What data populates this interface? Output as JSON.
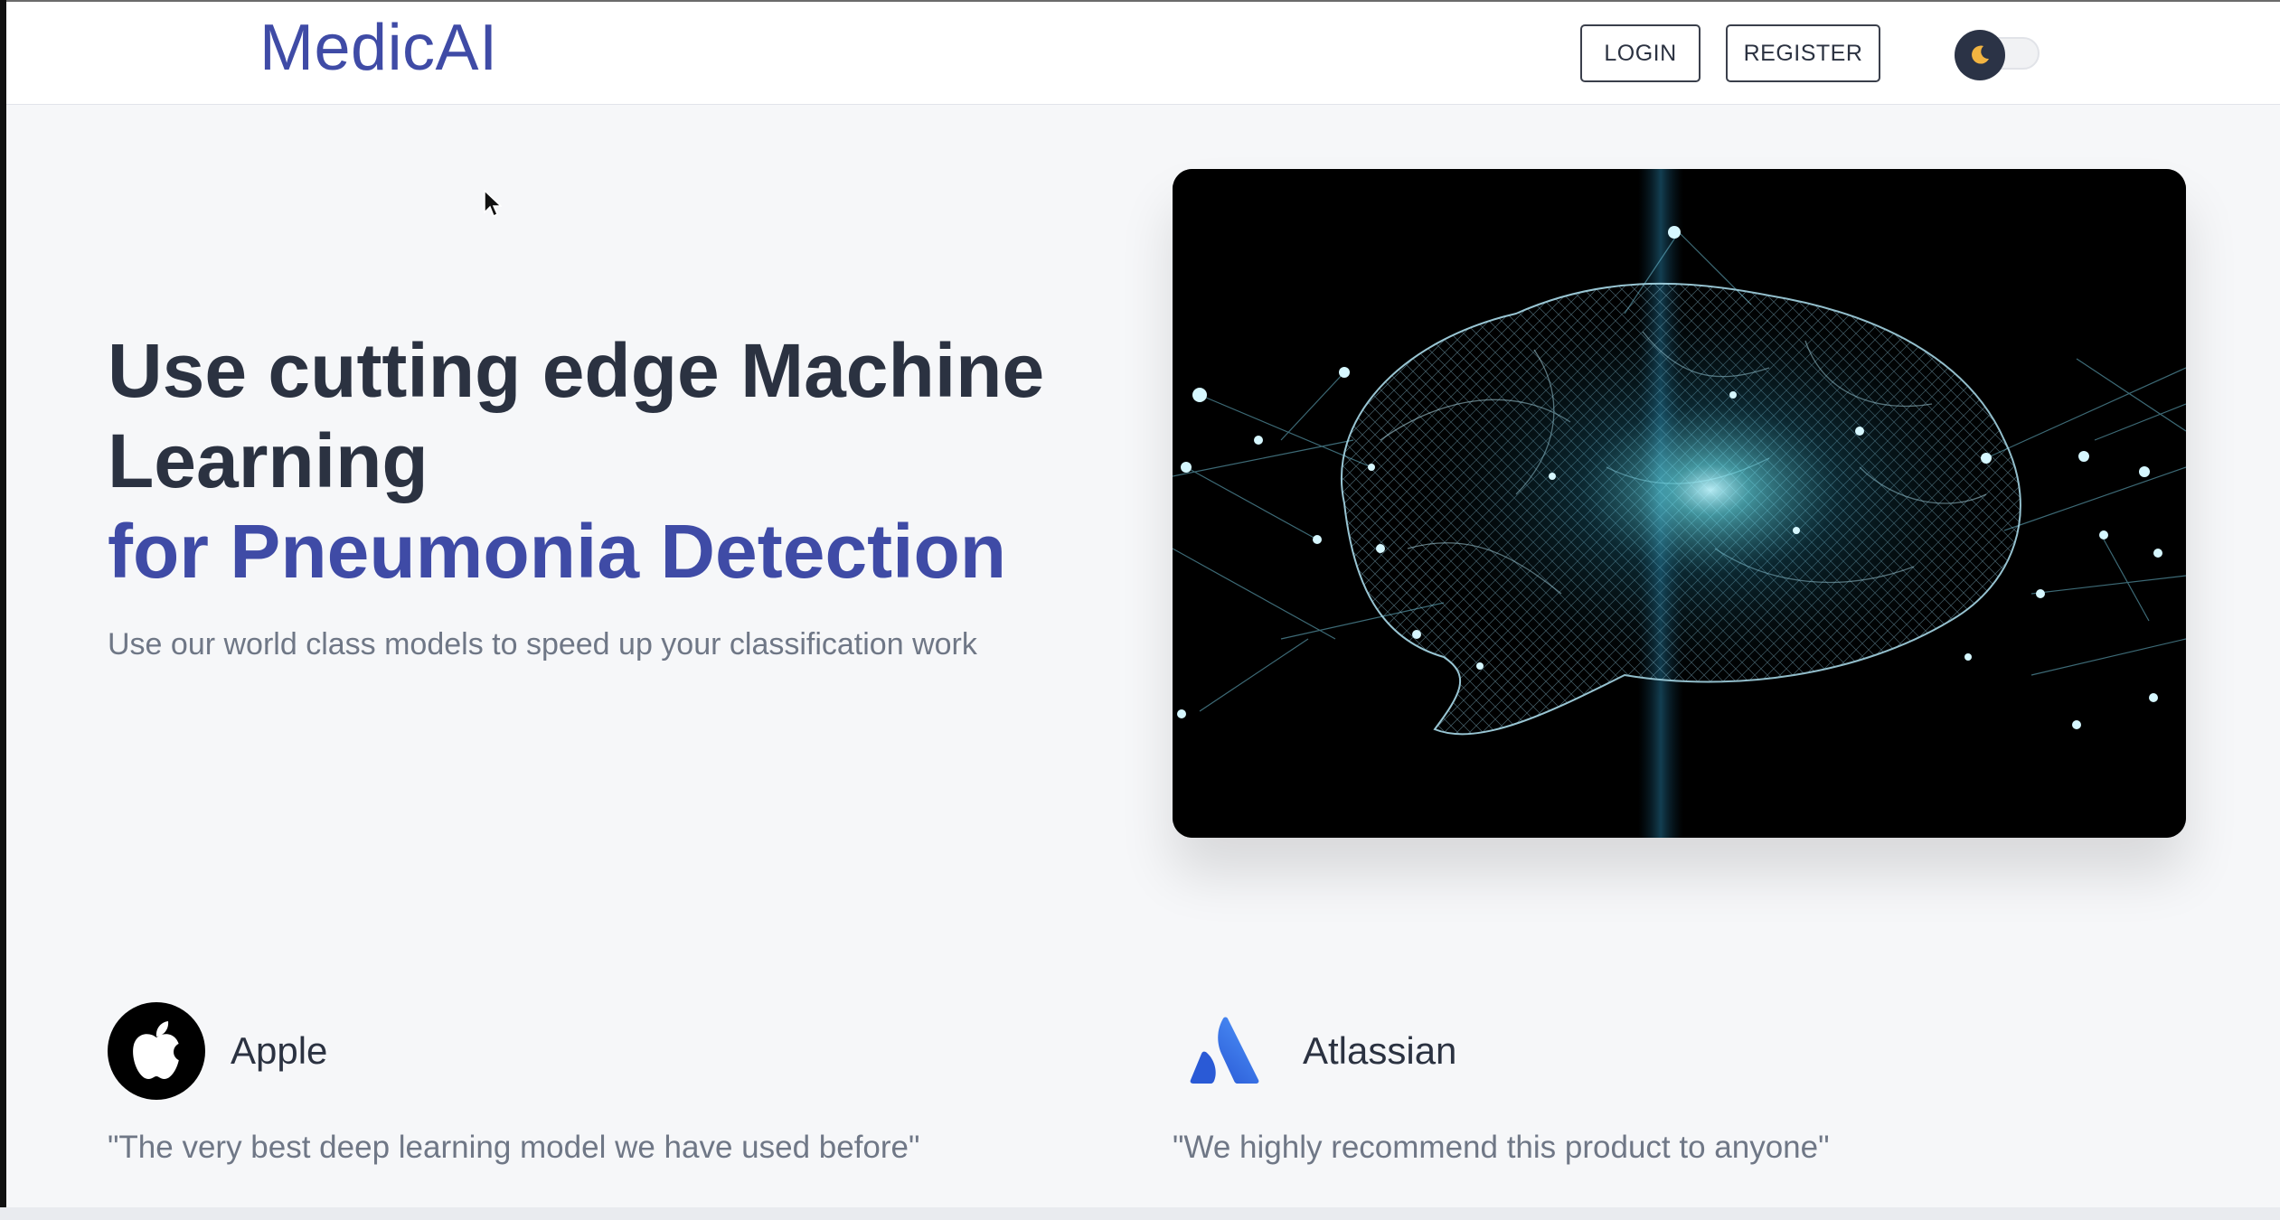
{
  "header": {
    "logo": "MedicAI",
    "login_label": "LOGIN",
    "register_label": "REGISTER",
    "theme_toggle_icon": "moon-icon"
  },
  "hero": {
    "title_line1": "Use cutting edge Machine Learning",
    "title_line2": "for Pneumonia Detection",
    "subtitle": "Use our world class models to speed up your classification work",
    "image_icon": "brain-network-image"
  },
  "testimonials": [
    {
      "company": "Apple",
      "icon": "apple-logo-icon",
      "quote": "\"The very best deep learning model we have used before\""
    },
    {
      "company": "Atlassian",
      "icon": "atlassian-logo-icon",
      "quote": "\"We highly recommend this product to anyone\""
    }
  ],
  "colors": {
    "brand": "#3f4ba6",
    "text": "#2b3241",
    "muted": "#6f7786",
    "background": "#f6f7f9"
  }
}
